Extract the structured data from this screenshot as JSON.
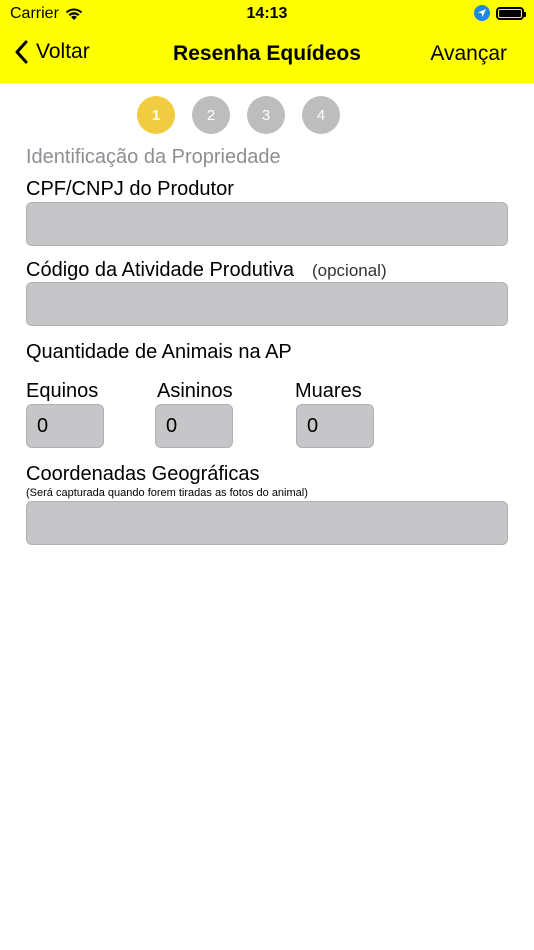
{
  "status_bar": {
    "carrier": "Carrier",
    "time": "14:13"
  },
  "nav": {
    "back_label": "Voltar",
    "title": "Resenha Equídeos",
    "forward_label": "Avançar"
  },
  "steps": [
    "1",
    "2",
    "3",
    "4"
  ],
  "active_step": 1,
  "form": {
    "section_title": "Identificação da Propriedade",
    "cpf_label": "CPF/CNPJ do Produtor",
    "cpf_value": "",
    "activity_label": "Código da Atividade Produtiva",
    "activity_optional": "(opcional)",
    "activity_value": "",
    "quantity_label": "Quantidade de Animais na AP",
    "equinos_label": "Equinos",
    "equinos_value": "0",
    "asininos_label": "Asininos",
    "asininos_value": "0",
    "muares_label": "Muares",
    "muares_value": "0",
    "coords_label": "Coordenadas Geográficas",
    "coords_note": "(Será capturada quando forem tiradas as fotos do animal)",
    "coords_value": ""
  },
  "colors": {
    "nav_background": "#ffff00",
    "step_active": "#f2cc40",
    "step_inactive": "#bdbdbd",
    "field_background": "#c6c6c8",
    "section_title": "#8e8e93",
    "location_icon": "#1e88e5"
  },
  "icons": {
    "wifi": "wifi-icon",
    "location": "location-arrow-icon",
    "battery": "battery-icon",
    "back": "chevron-left-icon"
  }
}
